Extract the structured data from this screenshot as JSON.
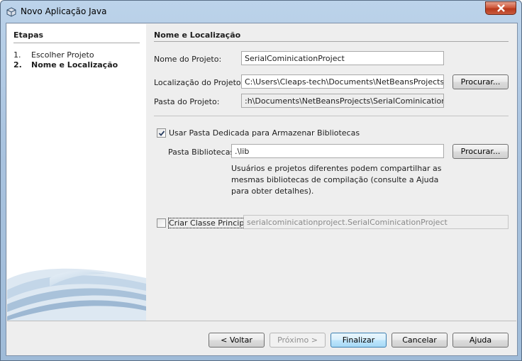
{
  "window": {
    "title": "Novo Aplicação Java"
  },
  "steps": {
    "title": "Etapas",
    "items": [
      {
        "num": "1.",
        "label": "Escolher Projeto",
        "current": false
      },
      {
        "num": "2.",
        "label": "Nome e Localização",
        "current": true
      }
    ]
  },
  "panel": {
    "title": "Nome e Localização",
    "project_name_label": "Nome do Projeto:",
    "project_name_value": "SerialCominicationProject",
    "location_label": "Localização do Projeto:",
    "location_value": "C:\\Users\\Cleaps-tech\\Documents\\NetBeansProjects",
    "browse_label": "Procurar...",
    "folder_label": "Pasta do Projeto:",
    "folder_value": ":h\\Documents\\NetBeansProjects\\SerialCominicationProject",
    "dedicated_folder_label": "Usar Pasta Dedicada para Armazenar Bibliotecas",
    "dedicated_folder_checked": true,
    "libraries_label": "Pasta Bibliotecas:",
    "libraries_value": ".\\lib",
    "libraries_browse_label": "Procurar...",
    "help_text": "Usuários e projetos diferentes podem compartilhar as mesmas bibliotecas de compilação (consulte a Ajuda para obter detalhes).",
    "main_class_label": "Criar Classe Principal",
    "main_class_checked": false,
    "main_class_value": "serialcominicationproject.SerialCominicationProject"
  },
  "buttons": {
    "back": "< Voltar",
    "next": "Próximo >",
    "finish": "Finalizar",
    "cancel": "Cancelar",
    "help": "Ajuda"
  },
  "colors": {
    "title_bar": "#a9c3df",
    "close_button": "#c8452a",
    "default_button": "#a7d9f5"
  }
}
